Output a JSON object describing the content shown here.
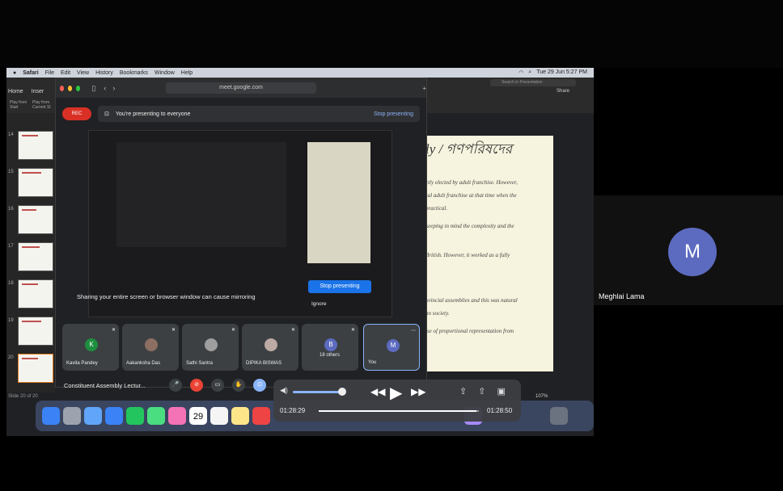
{
  "menubar": {
    "items": [
      "Safari",
      "File",
      "Edit",
      "View",
      "History",
      "Bookmarks",
      "Window",
      "Help"
    ],
    "clock": "Tue 29 Jun 5:27 PM",
    "search_placeholder": "Search in Presentation"
  },
  "keynote": {
    "tabs": [
      "Home",
      "Inser"
    ],
    "buttons": [
      "Play from Start",
      "Play from Current Sl"
    ],
    "thumbnail_numbers": [
      "14",
      "15",
      "16",
      "17",
      "18",
      "19",
      "20"
    ],
    "slide_count": "Slide 20 of 20",
    "share": "Share"
  },
  "slide": {
    "title": "ly / গণপরিষদের",
    "lines": [
      "ctly elected by adult franchise. However,",
      "sal adult franchise at that time when the",
      "practical.",
      "keeping in mind the complexity and the",
      "British. However, it worked as a fully",
      "ovincial assemblies and this was natural",
      "an society.",
      "ise of proportional representation from"
    ]
  },
  "browser": {
    "url": "meet.google.com"
  },
  "meet": {
    "rec_label": "REC",
    "banner_text": "You're presenting to everyone",
    "stop_presenting_link": "Stop presenting",
    "stop_presenting_button": "Stop presenting",
    "warning": "Sharing your entire screen or browser window can cause mirroring",
    "ignore": "Ignore",
    "meeting_title": "Constituent Assembly Lectur...",
    "tiles": [
      {
        "initial": "K",
        "name": "Kavita Pandey",
        "color": "#1e8e3e"
      },
      {
        "initial": "",
        "name": "Aakanksha Das",
        "color": "#8d6e63"
      },
      {
        "initial": "",
        "name": "Sathi Santra",
        "color": "#9e9e9e"
      },
      {
        "initial": "",
        "name": "DIPIKA BISWAS",
        "color": "#bcaaa4"
      },
      {
        "initial": "B",
        "name": "18 others",
        "color": "#5c6bc0"
      },
      {
        "initial": "M",
        "name": "You",
        "color": "#5c6bc0"
      }
    ]
  },
  "dock": {
    "calendar_day": "29",
    "zoom": "107%"
  },
  "player": {
    "elapsed": "01:28:29",
    "total": "01:28:50",
    "progress": 0.985,
    "volume": 0.9
  },
  "participant": {
    "initial": "M",
    "name": "Meghlai Lama"
  }
}
